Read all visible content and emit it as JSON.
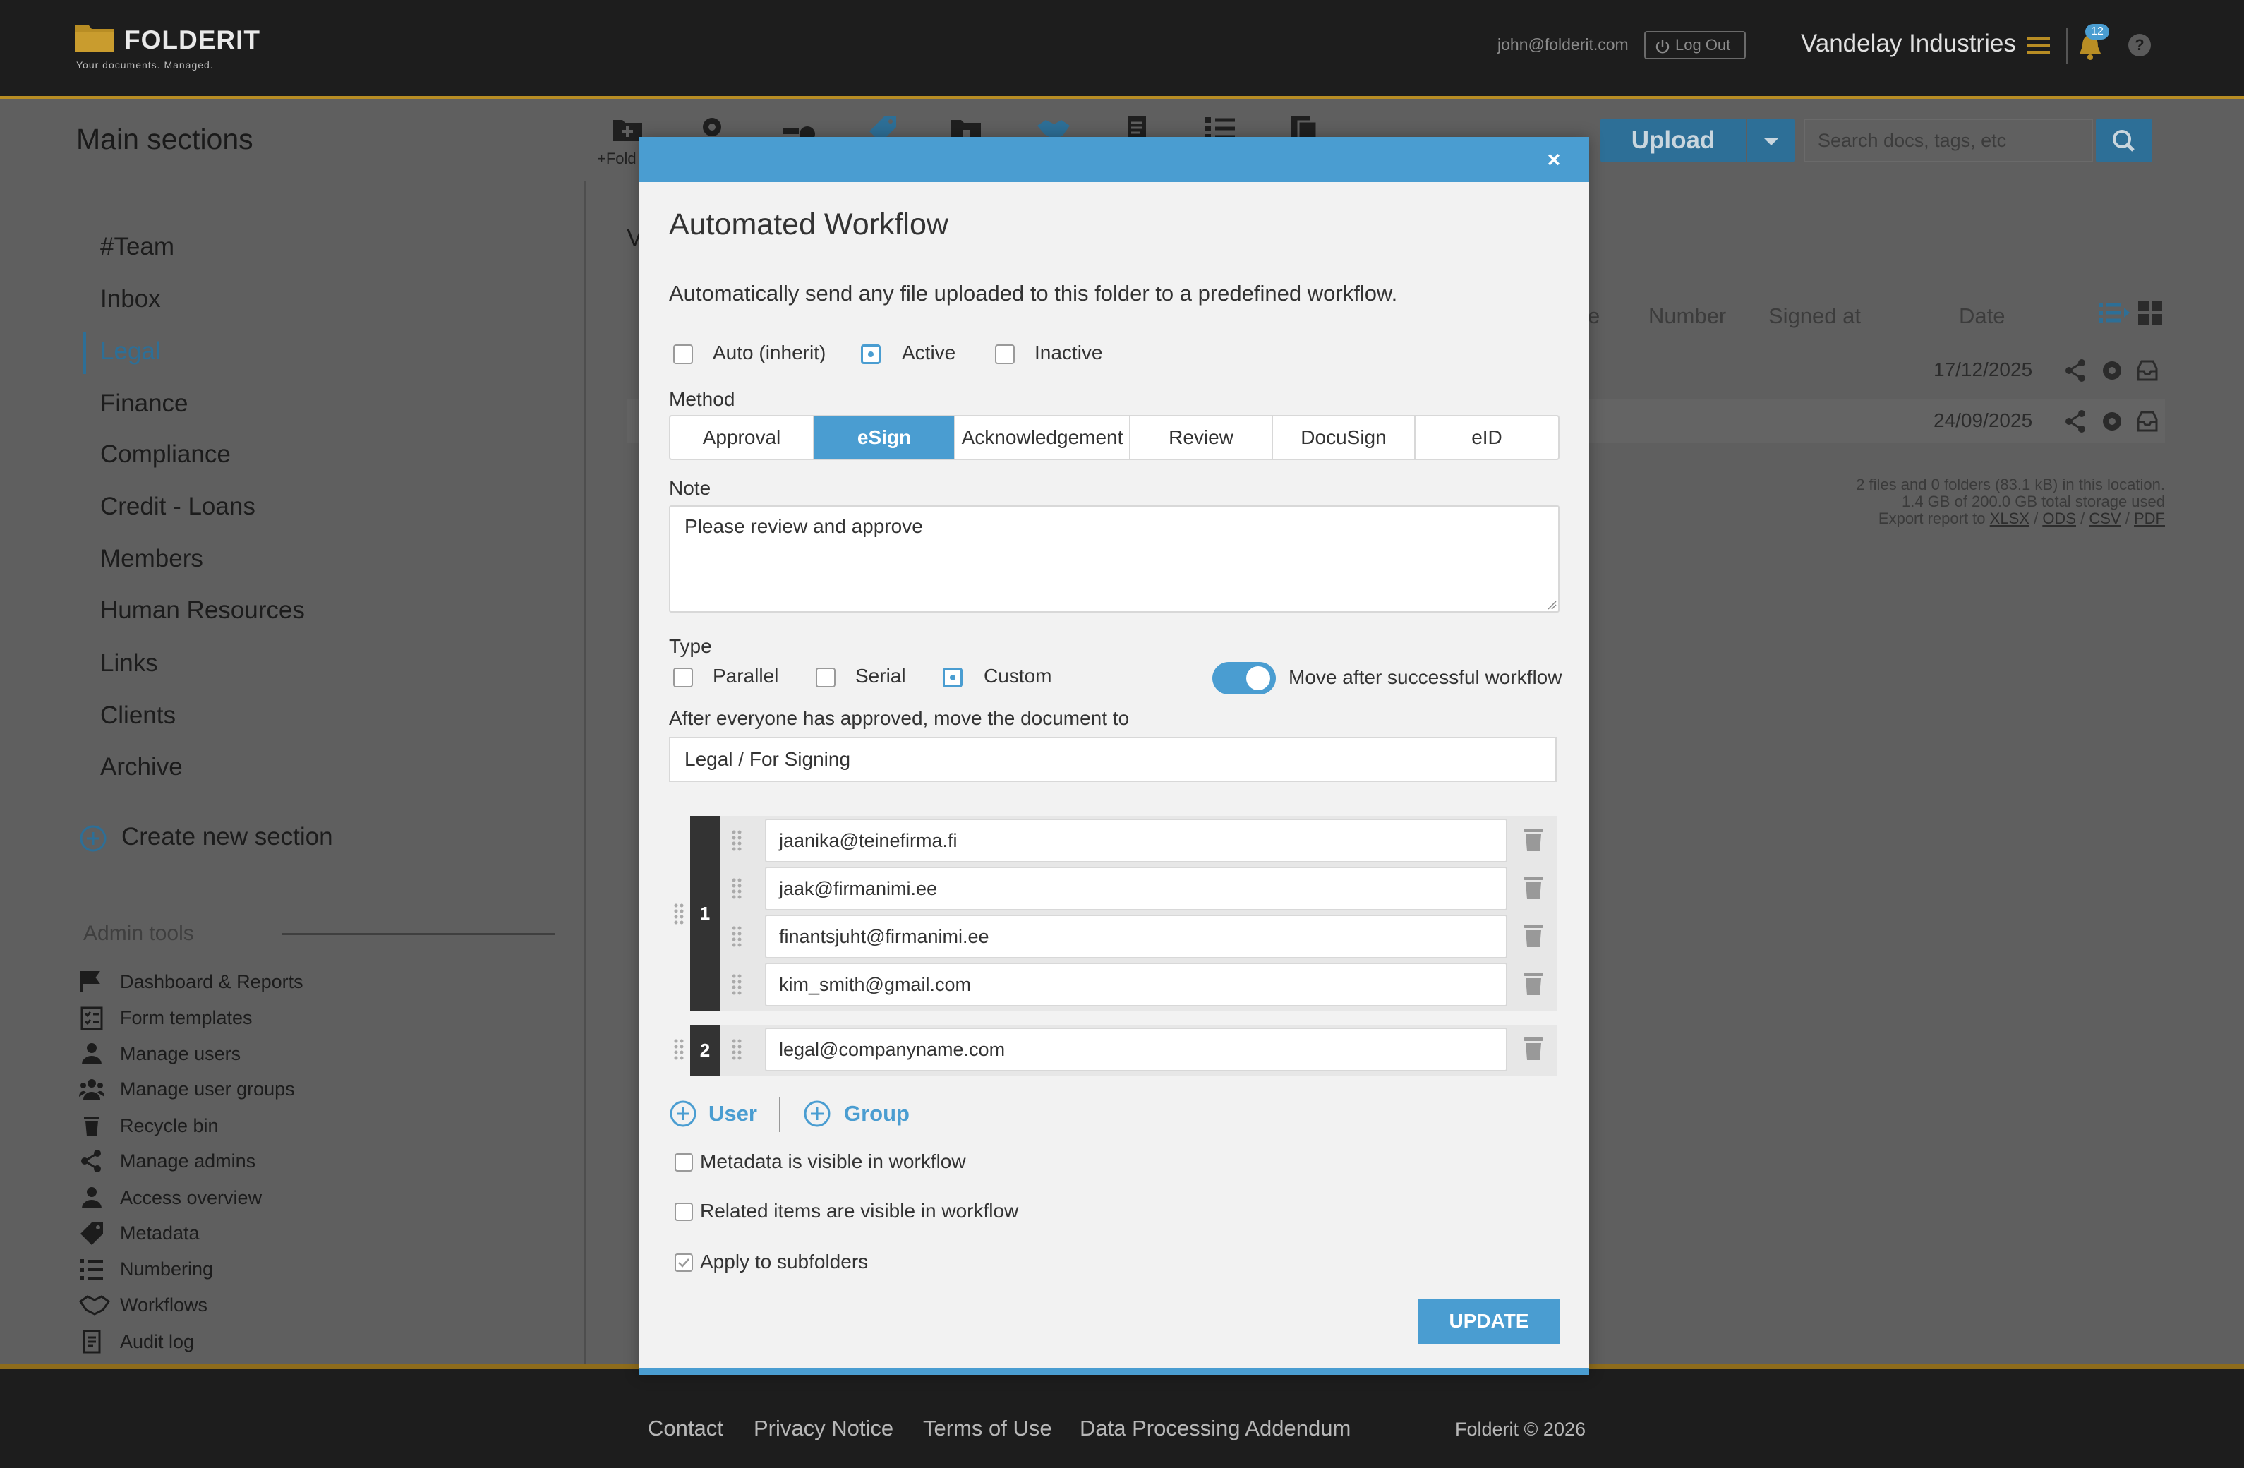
{
  "header": {
    "logo_text": "FOLDERIT",
    "tagline": "Your documents. Managed.",
    "user_email": "john@folderit.com",
    "logout_label": "Log Out",
    "company_name": "Vandelay Industries",
    "notification_count": "12",
    "help_label": "?"
  },
  "subheader": {
    "title": "Main sections",
    "folder_label": "+Fold",
    "upload_label": "Upload",
    "search_placeholder": "Search docs, tags, etc"
  },
  "sidebar": {
    "items": [
      {
        "label": "#Team"
      },
      {
        "label": "Inbox"
      },
      {
        "label": "Legal"
      },
      {
        "label": "Finance"
      },
      {
        "label": "Compliance"
      },
      {
        "label": "Credit - Loans"
      },
      {
        "label": "Members"
      },
      {
        "label": "Human Resources"
      },
      {
        "label": "Links"
      },
      {
        "label": "Clients"
      },
      {
        "label": "Archive"
      }
    ],
    "create_label": "Create new section",
    "admin_title": "Admin tools",
    "admin_items": [
      {
        "label": "Dashboard & Reports",
        "icon": "flag-icon"
      },
      {
        "label": "Form templates",
        "icon": "checklist-icon"
      },
      {
        "label": "Manage users",
        "icon": "user-icon"
      },
      {
        "label": "Manage user groups",
        "icon": "users-icon"
      },
      {
        "label": "Recycle bin",
        "icon": "trash-icon"
      },
      {
        "label": "Manage admins",
        "icon": "share-icon"
      },
      {
        "label": "Access overview",
        "icon": "user-icon"
      },
      {
        "label": "Metadata",
        "icon": "tag-icon"
      },
      {
        "label": "Numbering",
        "icon": "list-icon"
      },
      {
        "label": "Workflows",
        "icon": "handshake-icon"
      },
      {
        "label": "Audit log",
        "icon": "document-icon"
      }
    ]
  },
  "content": {
    "partial_letter": "V",
    "columns": {
      "col_partial": "e",
      "number": "Number",
      "signed_at": "Signed at",
      "date": "Date"
    },
    "rows": [
      {
        "date": "17/12/2025"
      },
      {
        "date": "24/09/2025"
      }
    ],
    "info_line1": "2 files and 0 folders (83.1 kB) in this location.",
    "info_line2": "1.4 GB of 200.0 GB total storage used",
    "export_prefix": "Export report to",
    "export_formats": [
      "XLSX",
      "ODS",
      "CSV",
      "PDF"
    ],
    "sep": "/"
  },
  "modal": {
    "close_label": "×",
    "title": "Automated Workflow",
    "description": "Automatically send any file uploaded to this folder to a predefined workflow.",
    "status_options": [
      {
        "label": "Auto (inherit)",
        "selected": false
      },
      {
        "label": "Active",
        "selected": true
      },
      {
        "label": "Inactive",
        "selected": false
      }
    ],
    "method_label": "Method",
    "methods": [
      {
        "label": "Approval",
        "active": false
      },
      {
        "label": "eSign",
        "active": true
      },
      {
        "label": "Acknowledgement",
        "active": false
      },
      {
        "label": "Review",
        "active": false
      },
      {
        "label": "DocuSign",
        "active": false
      },
      {
        "label": "eID",
        "active": false
      }
    ],
    "note_label": "Note",
    "note_value": "Please review and approve",
    "type_label": "Type",
    "type_options": [
      {
        "label": "Parallel",
        "selected": false
      },
      {
        "label": "Serial",
        "selected": false
      },
      {
        "label": "Custom",
        "selected": true
      }
    ],
    "move_toggle_label": "Move after successful workflow",
    "move_toggle_on": true,
    "destination_label": "After everyone has approved, move the document to",
    "destination_value": "Legal / For Signing",
    "steps": [
      {
        "number": "1",
        "emails": [
          "jaanika@teinefirma.fi",
          "jaak@firmanimi.ee",
          "finantsjuht@firmanimi.ee",
          "kim_smith@gmail.com"
        ]
      },
      {
        "number": "2",
        "emails": [
          "legal@companyname.com"
        ]
      }
    ],
    "add_user_label": "User",
    "add_group_label": "Group",
    "checkboxes": [
      {
        "label": "Metadata is visible in workflow",
        "checked": false
      },
      {
        "label": "Related items are visible in workflow",
        "checked": false
      },
      {
        "label": "Apply to subfolders",
        "checked": true
      }
    ],
    "update_label": "UPDATE"
  },
  "footer": {
    "links": [
      "Contact",
      "Privacy Notice",
      "Terms of Use",
      "Data Processing Addendum"
    ],
    "copyright": "Folderit © 2026"
  },
  "colors": {
    "accent": "#4a9dd1",
    "gold": "#b88d24",
    "header_bg": "#1d1d1d"
  }
}
